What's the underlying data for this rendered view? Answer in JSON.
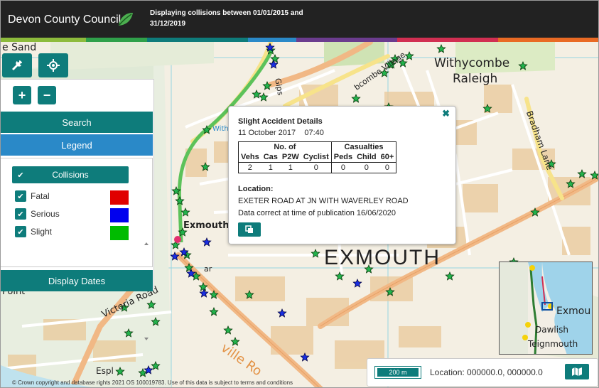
{
  "header": {
    "council_name": "Devon County Council",
    "message": "Displaying collisions between 01/01/2015 and 31/12/2019",
    "stripe_colors": [
      "#8dbb3c",
      "#2fa04a",
      "#0e7c7b",
      "#2a89c8",
      "#6b3c8e",
      "#d12f52",
      "#e96a24"
    ]
  },
  "map": {
    "place_labels": {
      "sand": "e Sand",
      "withycombe": "Withycombe",
      "raleigh": "Raleigh",
      "exmouth_small": "Exmouth",
      "exmouth_big": "EXMOUTH",
      "victoria_road": "Victoria Road",
      "esplanade": "Espl",
      "ville_road": "ville Ro",
      "bradham_lane": "Bradham Lane",
      "gipsy": "Gips",
      "withycombe_village": "bcombe Village",
      "with": "With",
      "point": "Point",
      "ar": "ar"
    },
    "inset_labels": {
      "exmou": "Exmou",
      "dawlish": "Dawlish",
      "teignmouth": "Teignmouth"
    }
  },
  "toolbar": {
    "settings_icon": "wrench-icon",
    "locate_icon": "locate-icon",
    "zoom_in": "+",
    "zoom_out": "−"
  },
  "panel": {
    "search_label": "Search",
    "legend_label": "Legend",
    "display_dates_label": "Display Dates",
    "collisions_label": "Collisions",
    "legend_items": [
      {
        "label": "Fatal",
        "color": "#e00000",
        "checked": true
      },
      {
        "label": "Serious",
        "color": "#0000ee",
        "checked": true
      },
      {
        "label": "Slight",
        "color": "#00bb00",
        "checked": true
      }
    ]
  },
  "popup": {
    "title": "Slight Accident Details",
    "date": "11 October 2017",
    "time": "07:40",
    "group_no_of": "No. of",
    "group_casualties": "Casualties",
    "columns": [
      "Vehs",
      "Cas",
      "P2W",
      "Cyclist",
      "Peds",
      "Child",
      "60+"
    ],
    "values": [
      "2",
      "1",
      "1",
      "0",
      "0",
      "0",
      "0"
    ],
    "location_heading": "Location:",
    "location": "EXETER ROAD AT JN WITH WAVERLEY ROAD",
    "correct_note": "Data correct at time of publication 16/06/2020",
    "close_symbol": "✖"
  },
  "status": {
    "scale_label": "200 m",
    "location": "Location: 000000.0, 000000.0"
  },
  "copyright": "© Crown copyright and database rights 2021 OS 100019783. Use of this data is subject to terms and conditions"
}
